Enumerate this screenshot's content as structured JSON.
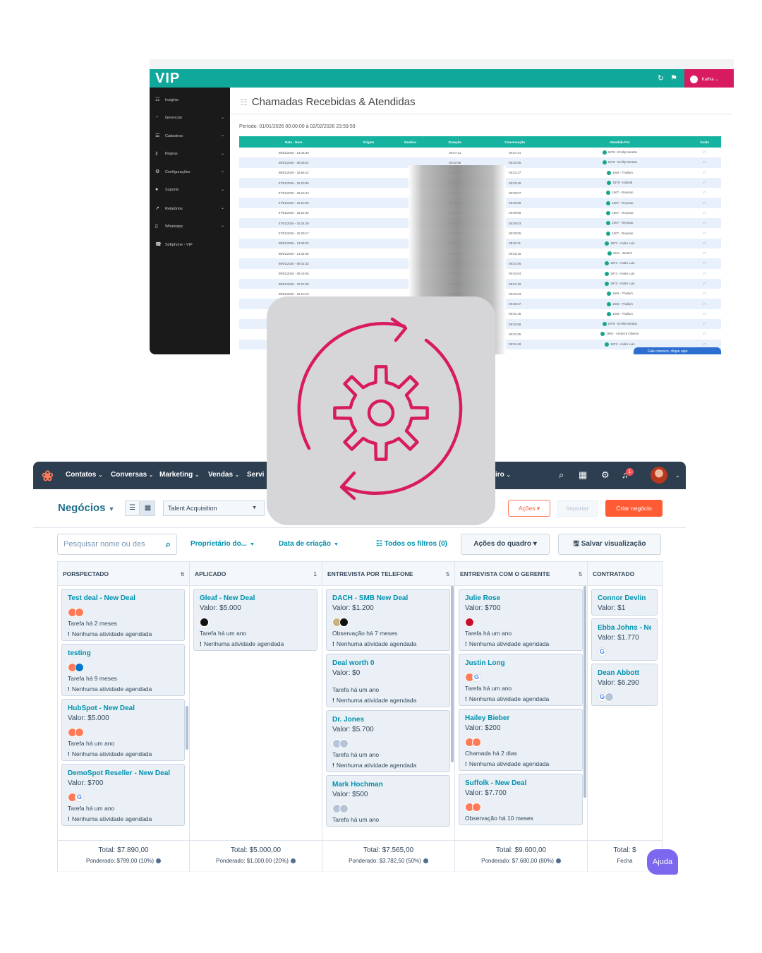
{
  "vip": {
    "browser_url": "",
    "logo": "VIP",
    "user": "Kathia",
    "sidebar": [
      {
        "label": "Insights",
        "icon": "chart-icon",
        "glyph": "☷",
        "chevron": false
      },
      {
        "label": "Gerenciar",
        "icon": "dashboard-icon",
        "glyph": "◔",
        "chevron": true
      },
      {
        "label": "Cadastros",
        "icon": "list-icon",
        "glyph": "☰",
        "chevron": true
      },
      {
        "label": "Regras",
        "icon": "rules-icon",
        "glyph": "⫫",
        "chevron": true
      },
      {
        "label": "Configurações",
        "icon": "gear-icon",
        "glyph": "⚙",
        "chevron": true
      },
      {
        "label": "Suporte",
        "icon": "info-icon",
        "glyph": "●",
        "chevron": true
      },
      {
        "label": "Relatórios",
        "icon": "reports-icon",
        "glyph": "↗",
        "chevron": true
      },
      {
        "label": "Whatsapp",
        "icon": "phone-icon",
        "glyph": "▯",
        "chevron": true
      },
      {
        "label": "Softphone - VIP",
        "icon": "softphone-icon",
        "glyph": "☎",
        "chevron": false
      }
    ],
    "page_title": "Chamadas Recebidas & Atendidas",
    "periodo": "Período:  01/01/2026 00:00:00   à   02/02/2026 23:59:59",
    "columns": [
      "Data - Hora",
      "Origem",
      "Destino",
      "Duração",
      "Conversação",
      "Atendida Por",
      "Áudio"
    ],
    "rows": [
      {
        "data": "05/01/2026 - 14:45:39",
        "duracao": "00:07:21",
        "conversacao": "00:07:21",
        "atendida": "1978 - Emilly Moratto"
      },
      {
        "data": "06/01/2026 - 09:35:01",
        "duracao": "00:02:56",
        "conversacao": "00:02:56",
        "atendida": "1978 - Emilly Moratto"
      },
      {
        "data": "06/01/2026 - 15:56:14",
        "duracao": "00:01:27",
        "conversacao": "00:01:27",
        "atendida": "1945 - Thailym"
      },
      {
        "data": "07/01/2026 - 15:20:35",
        "duracao": "00:03:49",
        "conversacao": "00:03:49",
        "atendida": "1976 - Isabela"
      },
      {
        "data": "07/01/2026 - 15:19:44",
        "duracao": "00:00:16",
        "conversacao": "00:00:07",
        "atendida": "1907 - Reynato"
      },
      {
        "data": "07/01/2026 - 15:20:29",
        "duracao": "00:00:13",
        "conversacao": "00:00:08",
        "atendida": "1907 - Reynato"
      },
      {
        "data": "07/01/2026 - 15:22:32",
        "duracao": "00:00:11",
        "conversacao": "00:00:06",
        "atendida": "1907 - Reynato"
      },
      {
        "data": "07/01/2026 - 15:24:29",
        "duracao": "00:00:07",
        "conversacao": "00:00:03",
        "atendida": "1907 - Reynato"
      },
      {
        "data": "07/01/2026 - 15:29:17",
        "duracao": "00:00:11",
        "conversacao": "00:00:05",
        "atendida": "1907 - Reynato"
      },
      {
        "data": "08/01/2026 - 13:36:03",
        "duracao": "00:02:11",
        "conversacao": "00:02:11",
        "atendida": "1973 - Andre Luis"
      },
      {
        "data": "08/01/2026 - 14:32:45",
        "duracao": "00:03:15",
        "conversacao": "00:03:15",
        "atendida": "1941 - Beatriz"
      },
      {
        "data": "09/01/2026 - 08:42:32",
        "duracao": "00:01:06",
        "conversacao": "00:01:06",
        "atendida": "1973 - Andre Luis"
      },
      {
        "data": "09/01/2026 - 08:43:46",
        "duracao": "00:04:04",
        "conversacao": "00:04:04",
        "atendida": "1973 - Andre Luis"
      },
      {
        "data": "09/01/2026 - 10:27:29",
        "duracao": "00:01:19",
        "conversacao": "00:01:19",
        "atendida": "1973 - Andre Luis"
      },
      {
        "data": "09/01/2026 - 16:10:13",
        "duracao": "00:01:03",
        "conversacao": "00:01:03",
        "atendida": "1945 - Thailym"
      },
      {
        "data": "09/01/2026 - 1",
        "duracao": "",
        "conversacao": "00:00:57",
        "atendida": "1945 - Thailym"
      },
      {
        "data": "12/01/",
        "duracao": "",
        "conversacao": "00:01:46",
        "atendida": "1945 - Thailym"
      },
      {
        "data": "12/01/",
        "duracao": "",
        "conversacao": "00:03:58",
        "atendida": "1978 - Emilly Moratto"
      },
      {
        "data": "12/01/",
        "duracao": "",
        "conversacao": "00:04:35",
        "atendida": "1962 - Andreza Oliveira"
      },
      {
        "data": "12/01/",
        "duracao": "",
        "conversacao": "00:04:48",
        "atendida": "1973 - Andre Luis"
      }
    ],
    "chat_pill": "Fale conosco, clique aqui"
  },
  "gear_tile": {
    "icon": "gear-sync-icon",
    "accent": "#d81b60"
  },
  "hub": {
    "nav": [
      {
        "label": "Contatos",
        "x": "c"
      },
      {
        "label": "Conversas"
      },
      {
        "label": "Marketing"
      },
      {
        "label": "Vendas"
      },
      {
        "label": "Servi"
      }
    ],
    "nav_tail": "iro",
    "bell_count": "1",
    "title": "Negócios",
    "pipeline": "Talent Acquisition",
    "btn_acoes": "Ações",
    "btn_importar": "Importar",
    "btn_criar": "Criar negócio",
    "search_placeholder": "Pesquisar nome ou des",
    "filter_owner": "Proprietário do...",
    "filter_date": "Data de criação",
    "filter_all": "Todos os filtros (0)",
    "btn_board_actions": "Ações do quadro",
    "btn_save_view": "Salvar visualização",
    "columns": [
      {
        "name": "PORSPECTADO",
        "count": "6",
        "total": "Total: $7.890,00",
        "ponderado": "Ponderado: $789,00 (10%)",
        "cards": [
          {
            "name": "Test deal - New Deal",
            "value": "",
            "avatars": [
              "hub",
              "hub"
            ],
            "task": "Tarefa há 2 meses",
            "act": "Nenhuma atividade agendada"
          },
          {
            "name": "testing",
            "value": "",
            "avatars": [
              "hub",
              "dell"
            ],
            "task": "Tarefa há 9 meses",
            "act": "Nenhuma atividade agendada"
          },
          {
            "name": "HubSpot - New Deal",
            "value": "Valor: $5.000",
            "avatars": [
              "hub",
              "hub"
            ],
            "task": "Tarefa há um ano",
            "act": "Nenhuma atividade agendada"
          },
          {
            "name": "DemoSpot Reseller - New Deal",
            "value": "Valor: $700",
            "avatars": [
              "hub",
              "g"
            ],
            "task": "Tarefa há um ano",
            "act": "Nenhuma atividade agendada"
          }
        ]
      },
      {
        "name": "APLICADO",
        "count": "1",
        "total": "Total: $5.000,00",
        "ponderado": "Ponderado: $1.000,00 (20%)",
        "cards": [
          {
            "name": "Gleaf - New Deal",
            "value": "Valor: $5.000",
            "avatars": [
              "dk"
            ],
            "task": "Tarefa há um ano",
            "act": "Nenhuma atividade agendada"
          }
        ]
      },
      {
        "name": "ENTREVISTA POR TELEFONE",
        "count": "5",
        "total": "Total: $7.565,00",
        "ponderado": "Ponderado: $3.782,50 (50%)",
        "cards": [
          {
            "name": "DACH - SMB New Deal",
            "value": "Valor: $1.200",
            "avatars": [
              "tn",
              "dk"
            ],
            "task": "Observação há 7 meses",
            "act": "Nenhuma atividade agendada"
          },
          {
            "name": "Deal worth 0",
            "value": "Valor: $0",
            "avatars": [],
            "task": "Tarefa há um ano",
            "act": "Nenhuma atividade agendada"
          },
          {
            "name": "Dr. Jones",
            "value": "Valor: $5.700",
            "avatars": [
              "gr",
              "gr"
            ],
            "task": "Tarefa há um ano",
            "act": "Nenhuma atividade agendada"
          },
          {
            "name": "Mark Hochman",
            "value": "Valor: $500",
            "avatars": [
              "gr",
              "gr"
            ],
            "task": "Tarefa há um ano",
            "act": ""
          }
        ]
      },
      {
        "name": "ENTREVISTA COM O GERENTE",
        "count": "5",
        "total": "Total: $9.600,00",
        "ponderado": "Ponderado: $7.680,00 (80%)",
        "cards": [
          {
            "name": "Julie Rose",
            "value": "Valor: $700",
            "avatars": [
              "red"
            ],
            "task": "Tarefa há um ano",
            "act": "Nenhuma atividade agendada"
          },
          {
            "name": "Justin Long",
            "value": "",
            "avatars": [
              "hub",
              "g"
            ],
            "task": "Tarefa há um ano",
            "act": "Nenhuma atividade agendada"
          },
          {
            "name": "Hailey Bieber",
            "value": "Valor: $200",
            "avatars": [
              "hub",
              "hub"
            ],
            "task": "Chamada há 2 dias",
            "act": "Nenhuma atividade agendada"
          },
          {
            "name": "Suffolk - New Deal",
            "value": "Valor: $7.700",
            "avatars": [
              "hub",
              "hub"
            ],
            "task": "Observação há 10 meses",
            "act": ""
          }
        ]
      },
      {
        "name": "CONTRATADO",
        "count": "",
        "total": "Total: $",
        "ponderado": "Fecha",
        "cards": [
          {
            "name": "Connor Devlin",
            "value": "Valor: $1",
            "avatars": [],
            "task": "",
            "act": ""
          },
          {
            "name": "Ebba Johns - New",
            "value": "Valor: $1.770",
            "avatars": [
              "g"
            ],
            "task": "",
            "act": ""
          },
          {
            "name": "Dean Abbott",
            "value": "Valor: $6.290",
            "avatars": [
              "g",
              "gr"
            ],
            "task": "",
            "act": ""
          }
        ]
      }
    ],
    "help": "Ajuda"
  }
}
